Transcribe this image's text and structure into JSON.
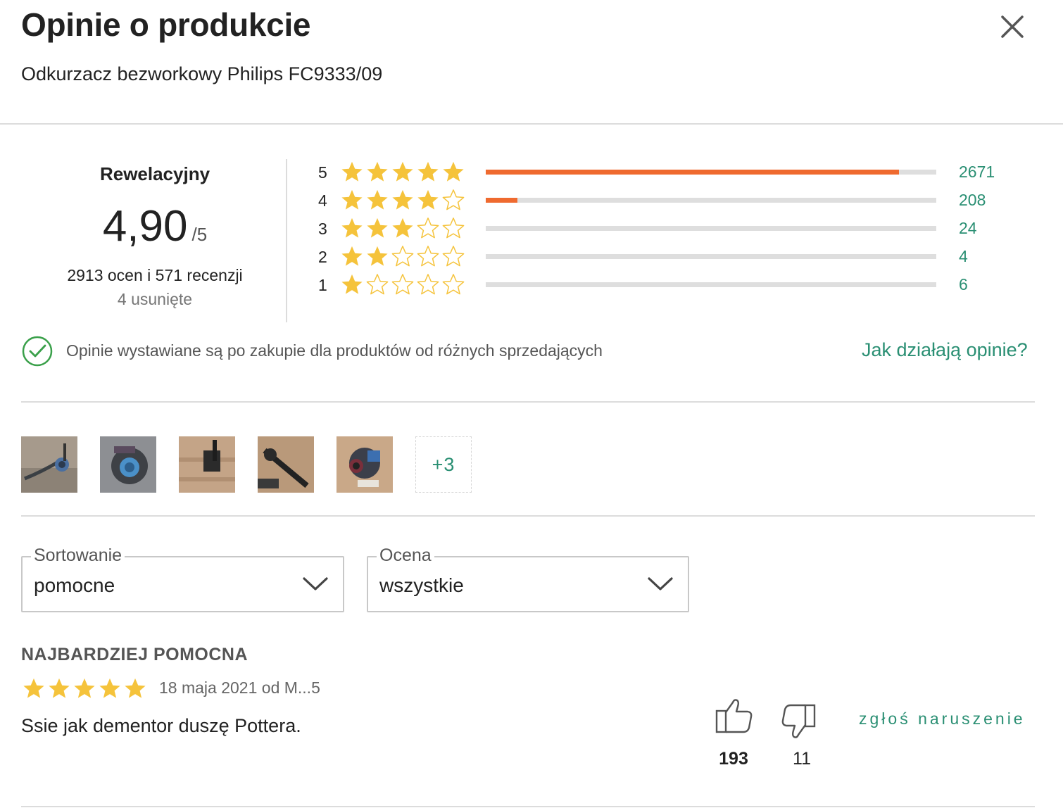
{
  "header": {
    "title": "Opinie o produkcie",
    "product_name": "Odkurzacz bezworkowy Philips FC9333/09"
  },
  "summary": {
    "label": "Rewelacyjny",
    "score": "4,90",
    "score_max": "/5",
    "counts_text": "2913 ocen i 571 recenzji",
    "removed_text": "4 usunięte"
  },
  "distribution": [
    {
      "stars": "5",
      "filled": 5,
      "count": "2671",
      "fraction": 0.917
    },
    {
      "stars": "4",
      "filled": 4,
      "count": "208",
      "fraction": 0.071
    },
    {
      "stars": "3",
      "filled": 3,
      "count": "24",
      "fraction": 0.0
    },
    {
      "stars": "2",
      "filled": 2,
      "count": "4",
      "fraction": 0.0
    },
    {
      "stars": "1",
      "filled": 1,
      "count": "6",
      "fraction": 0.0
    }
  ],
  "info": {
    "text": "Opinie wystawiane są po zakupie dla produktów od różnych sprzedających",
    "link": "Jak działają opinie?"
  },
  "gallery": {
    "more_label": "+3"
  },
  "filters": {
    "sort": {
      "label": "Sortowanie",
      "value": "pomocne"
    },
    "rating": {
      "label": "Ocena",
      "value": "wszystkie"
    }
  },
  "review": {
    "heading": "NAJBARDZIEJ POMOCNA",
    "rating": 5,
    "meta": "18 maja 2021 od M...5",
    "text": "Ssie jak dementor duszę Pottera.",
    "likes": "193",
    "dislikes": "11",
    "report_label": "zgłoś naruszenie"
  },
  "colors": {
    "accent": "#2a8f73",
    "bar_fill": "#ef6a2f",
    "star": "#f5c33b",
    "check": "#3aa04a"
  }
}
